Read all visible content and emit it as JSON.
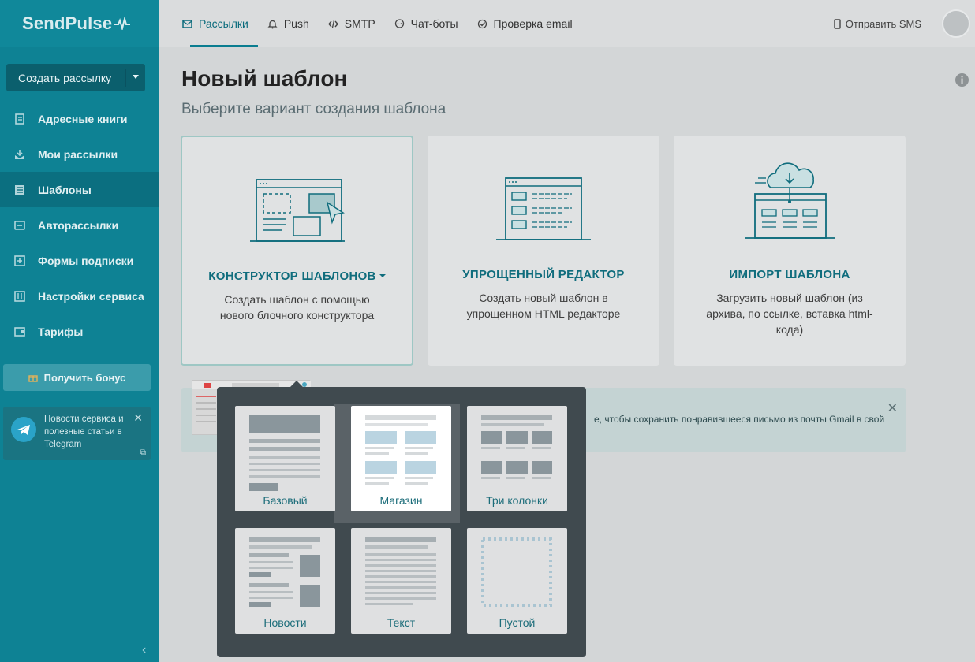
{
  "brand": {
    "logo": "SendPulse",
    "accent": "#0e8294",
    "accent_dark": "#0b5f6d"
  },
  "sidebar": {
    "create_button": "Создать рассылку",
    "items": [
      {
        "label": "Адресные книги",
        "icon": "address-book-icon",
        "active": false
      },
      {
        "label": "Мои рассылки",
        "icon": "campaign-icon",
        "active": false
      },
      {
        "label": "Шаблоны",
        "icon": "template-icon",
        "active": true
      },
      {
        "label": "Авторассылки",
        "icon": "automation-icon",
        "active": false
      },
      {
        "label": "Формы подписки",
        "icon": "form-icon",
        "active": false
      },
      {
        "label": "Настройки сервиса",
        "icon": "settings-icon",
        "active": false
      },
      {
        "label": "Тарифы",
        "icon": "pricing-icon",
        "active": false
      }
    ],
    "bonus_button": "Получить бонус",
    "telegram_card": {
      "text": "Новости сервиса и полезные статьи в Telegram"
    }
  },
  "topbar": {
    "tabs": [
      {
        "label": "Рассылки",
        "icon": "mail-icon",
        "active": true
      },
      {
        "label": "Push",
        "icon": "bell-icon",
        "active": false
      },
      {
        "label": "SMTP",
        "icon": "code-icon",
        "active": false
      },
      {
        "label": "Чат-боты",
        "icon": "chat-icon",
        "active": false
      },
      {
        "label": "Проверка email",
        "icon": "check-icon",
        "active": false
      }
    ],
    "sms_link": "Отправить SMS"
  },
  "main": {
    "title": "Новый шаблон",
    "subtitle": "Выберите вариант создания шаблона",
    "cards": [
      {
        "title": "КОНСТРУКТОР ШАБЛОНОВ",
        "description": "Создать шаблон с помощью нового блочного конструктора"
      },
      {
        "title": "УПРОЩЕННЫЙ РЕДАКТОР",
        "description": "Создать новый шаблон в упрощенном HTML редакторе"
      },
      {
        "title": "ИМПОРТ ШАБЛОНА",
        "description": "Загрузить новый шаблон (из архива, по ссылке, вставка html-кода)"
      }
    ],
    "banner_text": "е, чтобы сохранить понравившееся письмо из почты Gmail в свой"
  },
  "dropdown": {
    "templates": [
      {
        "label": "Базовый",
        "selected": false
      },
      {
        "label": "Магазин",
        "selected": true
      },
      {
        "label": "Три колонки",
        "selected": false
      },
      {
        "label": "Новости",
        "selected": false
      },
      {
        "label": "Текст",
        "selected": false
      },
      {
        "label": "Пустой",
        "selected": false
      }
    ]
  }
}
